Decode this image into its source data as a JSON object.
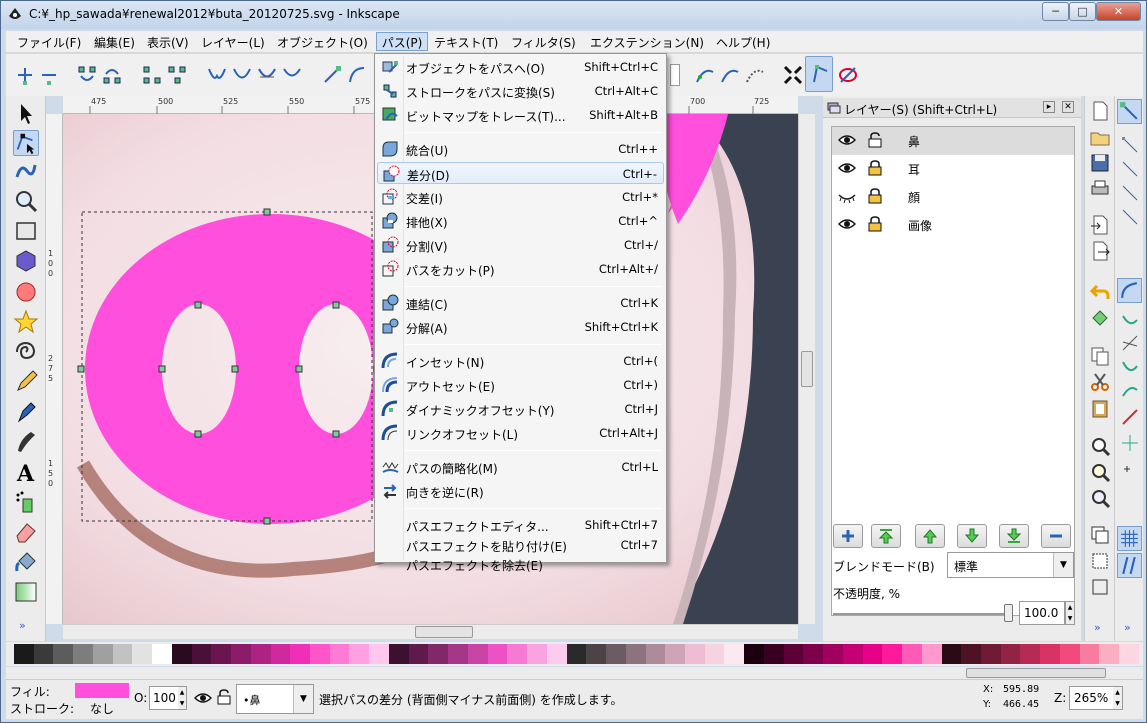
{
  "window": {
    "title": "C:¥_hp_sawada¥renewal2012¥buta_20120725.svg - Inkscape",
    "controls": {
      "minimize": "─",
      "maximize": "□",
      "close": "✕"
    }
  },
  "menubar": [
    "ファイル(F)",
    "編集(E)",
    "表示(V)",
    "レイヤー(L)",
    "オブジェクト(O)",
    "パス(P)",
    "テキスト(T)",
    "フィルタ(S)",
    "エクステンション(N)",
    "ヘルプ(H)"
  ],
  "active_menu": "パス(P)",
  "path_menu": {
    "groups": [
      [
        {
          "label": "オブジェクトをパスへ(O)",
          "accel": "Shift+Ctrl+C",
          "icon": "object-to-path-icon"
        },
        {
          "label": "ストロークをパスに変換(S)",
          "accel": "Ctrl+Alt+C",
          "icon": "stroke-to-path-icon"
        },
        {
          "label": "ビットマップをトレース(T)...",
          "accel": "Shift+Alt+B",
          "icon": "trace-bitmap-icon"
        }
      ],
      [
        {
          "label": "統合(U)",
          "accel": "Ctrl++",
          "icon": "union-icon"
        },
        {
          "label": "差分(D)",
          "accel": "Ctrl+-",
          "icon": "difference-icon",
          "highlighted": true
        },
        {
          "label": "交差(I)",
          "accel": "Ctrl+*",
          "icon": "intersection-icon"
        },
        {
          "label": "排他(X)",
          "accel": "Ctrl+^",
          "icon": "exclusion-icon"
        },
        {
          "label": "分割(V)",
          "accel": "Ctrl+/",
          "icon": "division-icon"
        },
        {
          "label": "パスをカット(P)",
          "accel": "Ctrl+Alt+/",
          "icon": "cut-path-icon"
        }
      ],
      [
        {
          "label": "連結(C)",
          "accel": "Ctrl+K",
          "icon": "combine-icon"
        },
        {
          "label": "分解(A)",
          "accel": "Shift+Ctrl+K",
          "icon": "break-apart-icon"
        }
      ],
      [
        {
          "label": "インセット(N)",
          "accel": "Ctrl+(",
          "icon": "inset-icon"
        },
        {
          "label": "アウトセット(E)",
          "accel": "Ctrl+)",
          "icon": "outset-icon"
        },
        {
          "label": "ダイナミックオフセット(Y)",
          "accel": "Ctrl+J",
          "icon": "dynamic-offset-icon"
        },
        {
          "label": "リンクオフセット(L)",
          "accel": "Ctrl+Alt+J",
          "icon": "linked-offset-icon"
        }
      ],
      [
        {
          "label": "パスの簡略化(M)",
          "accel": "Ctrl+L",
          "icon": "simplify-icon"
        },
        {
          "label": "向きを逆に(R)",
          "accel": "",
          "icon": "reverse-icon"
        }
      ],
      [
        {
          "label": "パスエフェクトエディタ...",
          "accel": "Shift+Ctrl+7",
          "icon": ""
        },
        {
          "label": "パスエフェクトを貼り付け(E)",
          "accel": "Ctrl+7",
          "icon": ""
        },
        {
          "label": "パスエフェクトを除去(E)",
          "accel": "",
          "icon": ""
        }
      ]
    ]
  },
  "ruler": {
    "top_ticks": [
      "475",
      "500",
      "525",
      "550",
      "575",
      "700",
      "725"
    ],
    "left_ticks": [
      "1",
      "0",
      "0",
      "2",
      "7",
      "5",
      "1",
      "5",
      "0"
    ]
  },
  "layers_panel": {
    "title": "レイヤー(S) (Shift+Ctrl+L)",
    "layers": [
      {
        "name": "鼻",
        "visible": true,
        "locked": false
      },
      {
        "name": "耳",
        "visible": true,
        "locked": true
      },
      {
        "name": "顔",
        "visible": false,
        "locked": true
      },
      {
        "name": "画像",
        "visible": true,
        "locked": true
      }
    ],
    "blend_label": "ブレンドモード(B)",
    "blend_value": "標準",
    "opacity_label": "不透明度, %",
    "opacity_value": "100.0",
    "opacity_fraction": 1.0
  },
  "colors": {
    "pink": "#ff4fdc",
    "accent": "#3b7bd6"
  },
  "statusbar": {
    "fill_label": "フィル:",
    "stroke_label": "ストローク:",
    "stroke_value": "なし",
    "opacity_label": "O:",
    "opacity_value": "100",
    "layer_value": "•鼻",
    "message": "選択パスの差分 (背面側マイナス前面側) を作成します。",
    "x_label": "X:",
    "x_value": "595.89",
    "y_label": "Y:",
    "y_value": "466.45",
    "zoom_label": "Z:",
    "zoom_value": "265%"
  },
  "palette": [
    "#1a1a1a",
    "#3a3a3a",
    "#5c5c5c",
    "#7d7d7d",
    "#a0a0a0",
    "#c2c2c2",
    "#e2e2e2",
    "#ffffff",
    "#2b0a1f",
    "#4b1037",
    "#6b1550",
    "#8c1b69",
    "#ad2283",
    "#cf299d",
    "#f02fb8",
    "#ff55c8",
    "#ff7ad5",
    "#ffa0e2",
    "#ffc6ee",
    "#3d1030",
    "#5e1a4b",
    "#822768",
    "#a63687",
    "#c944a5",
    "#ec52c4",
    "#f67ad3",
    "#faa3e1",
    "#fdcbee",
    "#2a2a2a",
    "#4b4346",
    "#6b5b62",
    "#8d737e",
    "#ae8b9a",
    "#cfa4b6",
    "#efbdd3",
    "#f5d3e1",
    "#fae9f0",
    "#1c0010",
    "#3a0022",
    "#5c0036",
    "#7e004a",
    "#a1005e",
    "#c40073",
    "#e70087",
    "#ff1a9c",
    "#ff5ab5",
    "#ff99ce",
    "#2a0a14",
    "#4d1224",
    "#701a35",
    "#932345",
    "#b62b55",
    "#d93366",
    "#f24a7d",
    "#f77c9f",
    "#fbadc2",
    "#fcd6e0"
  ]
}
